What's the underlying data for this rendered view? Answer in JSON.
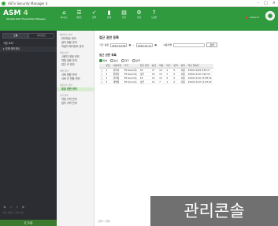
{
  "app": {
    "title": "ASTx Security Manager 4"
  },
  "brand": {
    "name_a": "ASM",
    "name_b": "4",
    "subtitle": "AhnLab Safe Transaction Manager"
  },
  "nav": [
    {
      "icon": "⌂",
      "label": "대시보드"
    },
    {
      "icon": "☰",
      "label": "이벤트"
    },
    {
      "icon": "✓",
      "label": "정책"
    },
    {
      "icon": "▮",
      "label": "통계"
    },
    {
      "icon": "▤",
      "label": "관리"
    },
    {
      "icon": "⚙",
      "label": "환경"
    },
    {
      "icon": "?",
      "label": "도움말"
    }
  ],
  "user": {
    "name": "admin ▾"
  },
  "sidebar": {
    "tabs": [
      "그룹",
      "에이전트"
    ],
    "rows": [
      "기본 트리",
      "▸ 전체 에이전트"
    ],
    "controls": [
      "◀",
      "◁",
      "▷",
      "▶"
    ],
    "status": "접속 사용자 · 관리 콘솔",
    "exit": "로그아웃"
  },
  "menu": [
    {
      "group": "에이전트 관리",
      "items": [
        "관리대상 관리",
        "설치 현황 관리",
        "미설치 에이전트 관리"
      ]
    },
    {
      "group": "계정 관리",
      "items": [
        "사용자 계정 관리",
        "역할 권한 관리",
        "접근 IP 관리"
      ]
    },
    {
      "group": "서버 관리",
      "items": [
        "서버 현황 관리",
        "서버 간 연동 관리"
      ]
    },
    {
      "group": "라이선스 관리",
      "items": [
        "등급 권한 관리"
      ]
    },
    {
      "group": "감사 관리",
      "items": [
        "작업 이력 관리",
        "접속 이력 관리"
      ]
    }
  ],
  "active_menu": "등급 권한 관리",
  "main": {
    "title": "접근 권한 등록",
    "period_label": "기간 설정",
    "date_from": "2019-10-09",
    "date_to": "2019-10-11",
    "search_label": "사용자명",
    "search_value": "",
    "search_button": "검색",
    "list_title": "접근 권한 목록",
    "radios": [
      "전체",
      "승인",
      "대기",
      "반려"
    ],
    "columns": [
      "",
      "번호",
      "사용자명",
      "부서",
      "접근 권한",
      "등급",
      "허용",
      "대기",
      "반려",
      "상태",
      "최근 접속일"
    ],
    "rows": [
      [
        "○",
        "1",
        "관리자",
        "ES Security",
        "CS",
        "17",
        "14",
        "1",
        "0",
        "사용",
        "2019-10-09 9:52:17"
      ],
      [
        "○",
        "2",
        "운영자",
        "ES Security",
        "보안",
        "14",
        "13",
        "1",
        "0",
        "사용",
        "2019-10-10 3:42:10"
      ],
      [
        "○",
        "3",
        "관리팀",
        "ES Security",
        "CS",
        "14",
        "13",
        "0",
        "0",
        "사용",
        "2019-10-10 11:58:16"
      ],
      [
        "○",
        "4",
        "개발팀",
        "ES Security",
        "보안",
        "14",
        "7",
        "1",
        "0",
        "사용",
        "2019-10-10 11:23:22"
      ]
    ],
    "footer": "선택 > 항목"
  },
  "overlay_text": "관리콘솔"
}
